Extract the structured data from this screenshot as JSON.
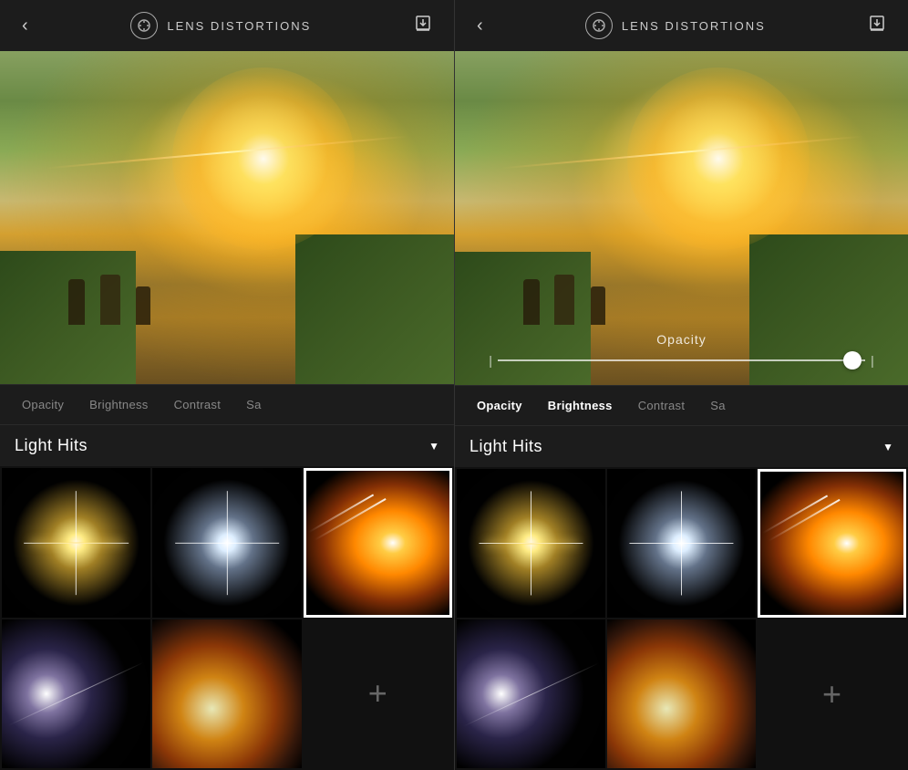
{
  "app": {
    "title": "LENS DISTORTIONS",
    "icon": "lens-icon"
  },
  "left_panel": {
    "header": {
      "back_label": "‹",
      "title": "LENS DISTORTIONS",
      "download_label": "⬇"
    },
    "toolbar": {
      "items": [
        {
          "id": "opacity",
          "label": "Opacity",
          "active": false
        },
        {
          "id": "brightness",
          "label": "Brightness",
          "active": false
        },
        {
          "id": "contrast",
          "label": "Contrast",
          "active": false
        },
        {
          "id": "saturation",
          "label": "Sa",
          "active": false
        }
      ]
    },
    "category": {
      "title": "Light Hits",
      "dropdown_icon": "▼"
    },
    "effects": [
      {
        "id": 1,
        "style": "star-warm",
        "selected": false
      },
      {
        "id": 2,
        "style": "star-cold",
        "selected": false
      },
      {
        "id": 3,
        "style": "glow-orange",
        "selected": true
      },
      {
        "id": 4,
        "style": "streak-white",
        "selected": false
      },
      {
        "id": 5,
        "style": "orb-big",
        "selected": false
      },
      {
        "id": 6,
        "style": "add",
        "selected": false
      }
    ]
  },
  "right_panel": {
    "header": {
      "back_label": "‹",
      "title": "LENS DISTORTIONS",
      "download_label": "⬇"
    },
    "opacity_slider": {
      "label": "Opacity",
      "value": 95
    },
    "toolbar": {
      "items": [
        {
          "id": "opacity",
          "label": "Opacity",
          "active": true
        },
        {
          "id": "brightness",
          "label": "Brightness",
          "active": true
        },
        {
          "id": "contrast",
          "label": "Contrast",
          "active": false
        },
        {
          "id": "saturation",
          "label": "Sa",
          "active": false
        }
      ]
    },
    "category": {
      "title": "Light Hits",
      "dropdown_icon": "▼"
    },
    "effects": [
      {
        "id": 1,
        "style": "star-warm",
        "selected": false
      },
      {
        "id": 2,
        "style": "star-cold",
        "selected": false
      },
      {
        "id": 3,
        "style": "glow-orange",
        "selected": true
      },
      {
        "id": 4,
        "style": "streak-white",
        "selected": false
      },
      {
        "id": 5,
        "style": "orb-big",
        "selected": false
      },
      {
        "id": 6,
        "style": "add",
        "selected": false
      }
    ]
  }
}
